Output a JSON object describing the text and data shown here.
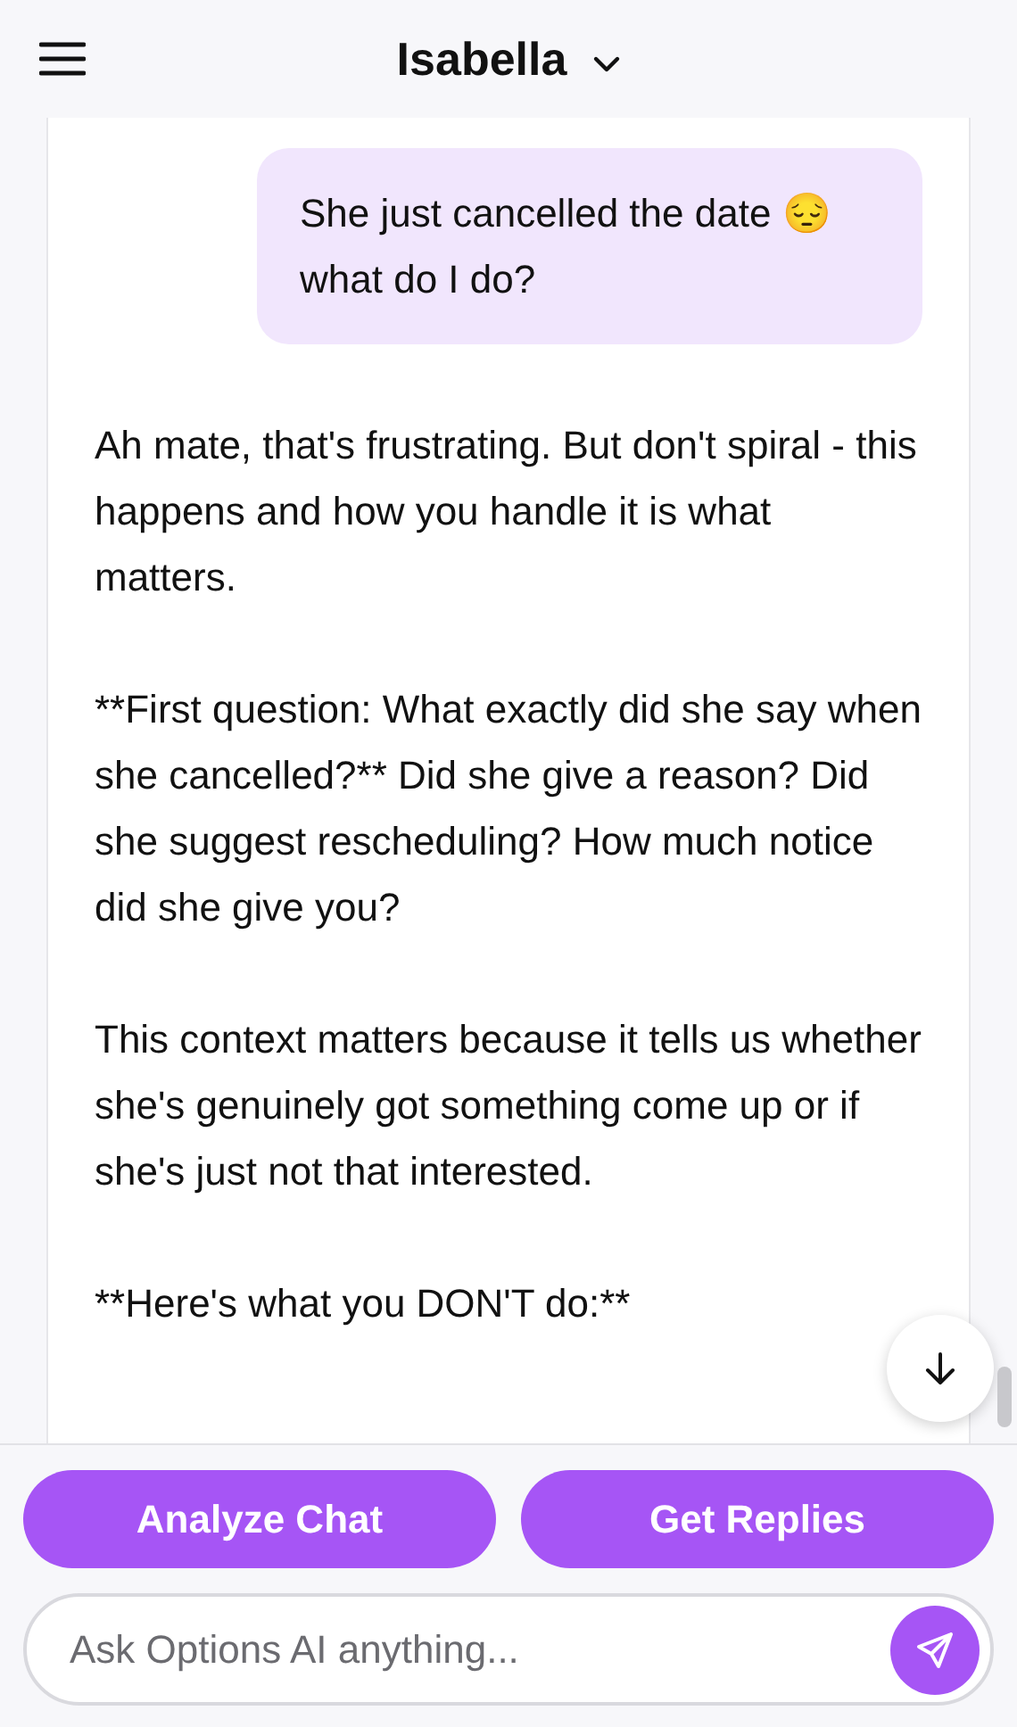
{
  "header": {
    "title": "Isabella"
  },
  "messages": [
    {
      "kind": "user",
      "text": "She just cancelled the date 😔 what do I do?"
    },
    {
      "kind": "assistant",
      "paragraphs": [
        "Ah mate, that's frustrating. But don't spiral - this happens and how you handle it is what matters.",
        "**First question: What exactly did she say when she cancelled?** Did she give a reason? Did she suggest rescheduling? How much notice did she give you?",
        "This context matters because it tells us whether she's genuinely got something come up or if she's just not that interested.",
        "**Here's what you DON'T do:**"
      ]
    }
  ],
  "actions": [
    "Analyze Chat",
    "Get Replies"
  ],
  "composer": {
    "placeholder": "Ask Options AI anything..."
  }
}
